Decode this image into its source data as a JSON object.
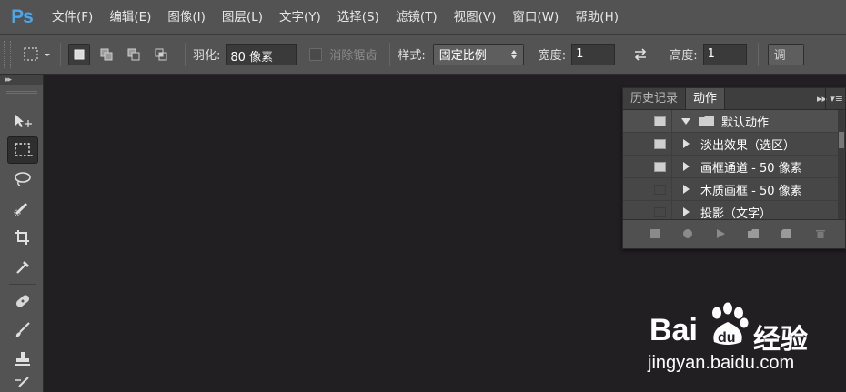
{
  "app": {
    "logo": "Ps"
  },
  "menu": [
    "文件(F)",
    "编辑(E)",
    "图像(I)",
    "图层(L)",
    "文字(Y)",
    "选择(S)",
    "滤镜(T)",
    "视图(V)",
    "窗口(W)",
    "帮助(H)"
  ],
  "options": {
    "feather_label": "羽化:",
    "feather_value": "80 像素",
    "antialias_label": "消除锯齿",
    "style_label": "样式:",
    "style_value": "固定比例",
    "width_label": "宽度:",
    "width_value": "1",
    "height_label": "高度:",
    "height_value": "1",
    "refine_edge_label": "调"
  },
  "toolbar_header": "▸▸",
  "panel": {
    "tabs": [
      "历史记录",
      "动作"
    ],
    "active_tab": "动作",
    "collapse_glyph": "▸▸",
    "menu_glyph": "▾≡",
    "actions": [
      {
        "label": "默认动作",
        "type": "set",
        "enabled": true
      },
      {
        "label": "淡出效果（选区）",
        "type": "item",
        "enabled": true
      },
      {
        "label": "画框通道 - 50 像素",
        "type": "item",
        "enabled": true
      },
      {
        "label": "木质画框 - 50 像素",
        "type": "item",
        "enabled": false
      },
      {
        "label": "投影（文字）",
        "type": "item",
        "enabled": false
      }
    ]
  },
  "watermark": {
    "brand": "Bai",
    "brand_du": "du",
    "brand_cn": "经验",
    "url": "jingyan.baidu.com"
  },
  "colors": {
    "logo": "#4aa6e8",
    "chrome": "#535353",
    "canvas": "#221f23"
  }
}
